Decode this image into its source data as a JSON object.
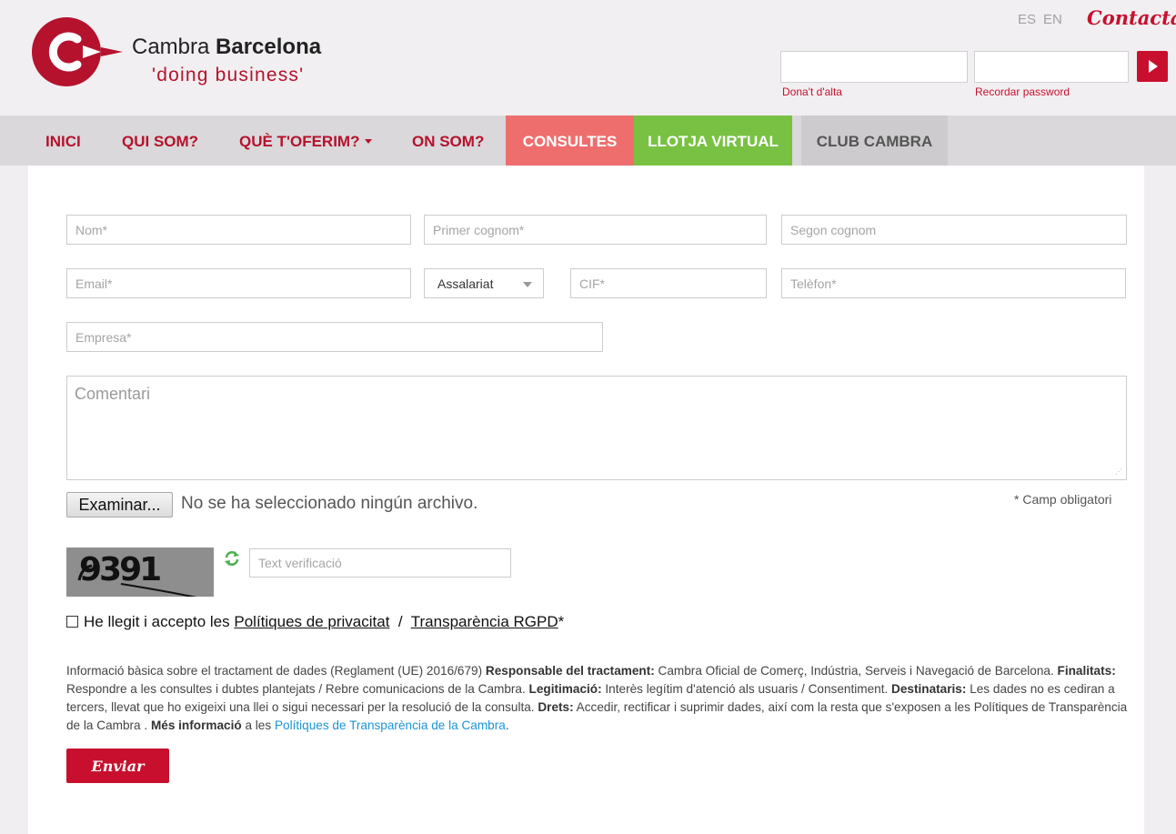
{
  "header": {
    "brand_light": "Cambra",
    "brand_bold": "Barcelona",
    "tagline": "'doing business'",
    "lang_es": "ES",
    "lang_en": "EN",
    "contact_link": "Contacta",
    "signup_link": "Dona't d'alta",
    "password_link": "Recordar password"
  },
  "nav": {
    "items": [
      {
        "label": "INICI"
      },
      {
        "label": "QUI SOM?"
      },
      {
        "label": "QUÈ T'OFERIM?"
      },
      {
        "label": "ON SOM?"
      },
      {
        "label": "CONSULTES"
      },
      {
        "label": "LLOTJA VIRTUAL"
      },
      {
        "label": "CLUB CAMBRA"
      }
    ]
  },
  "form": {
    "nom_placeholder": "Nom*",
    "cognom1_placeholder": "Primer cognom*",
    "cognom2_placeholder": "Segon cognom",
    "email_placeholder": "Email*",
    "tipus_value": "Assalariat",
    "cif_placeholder": "CIF*",
    "telefon_placeholder": "Telèfon*",
    "empresa_placeholder": "Empresa*",
    "comentari_placeholder": "Comentari",
    "file_button": "Examinar...",
    "file_status": "No se ha seleccionado ningún archivo.",
    "required_note": "* Camp obligatori",
    "captcha_text": "9391",
    "captcha_placeholder": "Text verificació",
    "consent_prefix": "He llegit i accepto les",
    "consent_link1": "Polítiques de privacitat",
    "consent_sep": "/",
    "consent_link2": "Transparència RGPD",
    "consent_suffix": "*",
    "submit_label": "Enviar"
  },
  "legal": {
    "intro": "Informació bàsica sobre el tractament de dades (Reglament (UE) 2016/679)",
    "responsable_label": "Responsable del tractament:",
    "responsable_text": "Cambra Oficial de Comerç, Indústria, Serveis i Navegació de Barcelona.",
    "finalitats_label": "Finalitats:",
    "finalitats_text": "Respondre a les consultes i dubtes plantejats / Rebre comunicacions de la Cambra.",
    "legitimacio_label": "Legitimació:",
    "legitimacio_text": "Interès legítim d'atenció als usuaris / Consentiment.",
    "destinataris_label": "Destinataris:",
    "destinataris_text": "Les dades no es cediran a tercers, llevat que ho exigeixi una llei o sigui necessari per la resolució de la consulta.",
    "drets_label": "Drets:",
    "drets_text": "Accedir, rectificar i suprimir dades, així com la resta que s'exposen a les Polítiques de Transparència de la Cambra .",
    "mes_label": "Més informació",
    "mes_text": "a les",
    "mes_link": "Polítiques de Transparència de la Cambra",
    "end": "."
  },
  "colors": {
    "brand_red": "#c8102e",
    "consultes_bg": "#ee6e6e",
    "llotja_bg": "#79c143",
    "link_blue": "#1b95d8"
  }
}
